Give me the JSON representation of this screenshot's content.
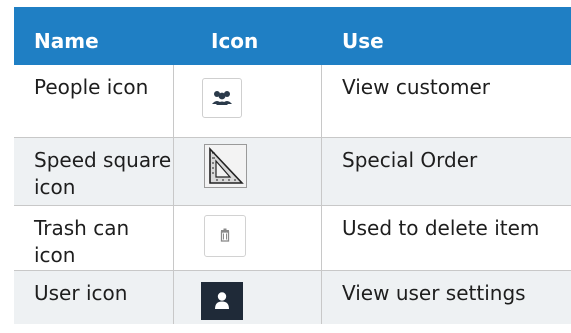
{
  "table": {
    "headers": {
      "name": "Name",
      "icon": "Icon",
      "use": "Use"
    },
    "rows": [
      {
        "name": "People icon",
        "icon": "people-icon",
        "use": "View customer"
      },
      {
        "name": "Speed square icon",
        "icon": "speed-square-icon",
        "use": "Special Order"
      },
      {
        "name": "Trash can icon",
        "icon": "trash-can-icon",
        "use": "Used to delete item"
      },
      {
        "name": "User icon",
        "icon": "user-icon",
        "use": "View user settings"
      }
    ]
  },
  "colors": {
    "header_bg": "#1f7fc4",
    "header_text": "#ffffff",
    "row_alt_bg": "#eef1f3",
    "border": "#c8c8c8",
    "user_icon_bg": "#1f2a38"
  }
}
